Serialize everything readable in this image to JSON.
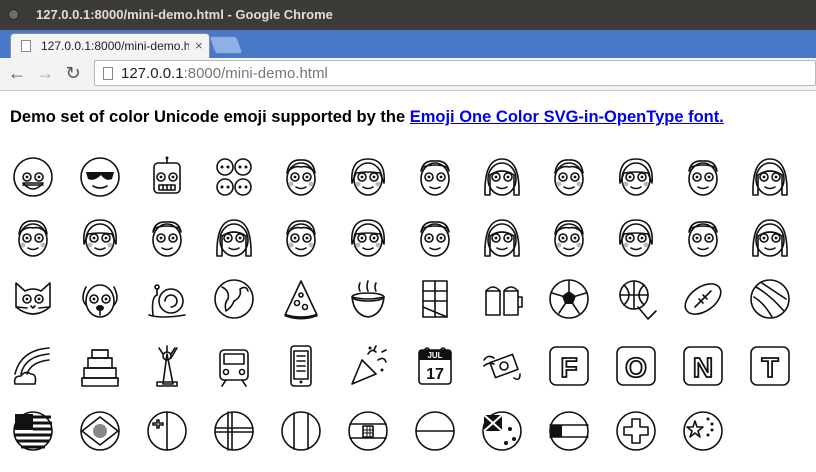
{
  "window": {
    "title": "127.0.0.1:8000/mini-demo.html - Google Chrome"
  },
  "tab": {
    "title": "127.0.0.1:8000/mini-demo.html",
    "close": "×"
  },
  "toolbar": {
    "back": "←",
    "forward": "→",
    "reload": "↻"
  },
  "address": {
    "host": "127.0.0.1",
    "rest": ":8000/mini-demo.html"
  },
  "page": {
    "heading_text": "Demo set of color Unicode emoji supported by the ",
    "heading_link": "Emoji One Color SVG-in-OpenType font."
  },
  "emoji_rows": [
    [
      "grinning-face",
      "sunglasses-face",
      "robot-face",
      "family",
      "boy",
      "girl",
      "man",
      "woman",
      "boy",
      "girl",
      "man",
      "woman"
    ],
    [
      "boy",
      "girl",
      "man",
      "woman",
      "boy",
      "girl",
      "man",
      "woman",
      "boy",
      "girl",
      "man",
      "woman"
    ],
    [
      "cat-face",
      "dog-face",
      "snail",
      "globe",
      "pizza",
      "stew",
      "chocolate-bar",
      "beer-mugs",
      "soccer-ball",
      "basketball",
      "football",
      "volleyball"
    ],
    [
      "rainbow",
      "japanese-castle",
      "statue-of-liberty",
      "train",
      "mobile-phone",
      "party-popper",
      "calendar",
      "money-wings",
      "letter-f",
      "letter-o",
      "letter-n",
      "letter-t"
    ],
    [
      "flag-us",
      "flag-br",
      "flag-mt",
      "flag-dk",
      "flag-it",
      "flag-hr",
      "flag-id",
      "flag-nz",
      "flag-ae",
      "flag-ch",
      "flag-cn"
    ]
  ],
  "letters": {
    "letter-f": "F",
    "letter-o": "O",
    "letter-n": "N",
    "letter-t": "T"
  },
  "calendar": {
    "month": "JUL",
    "day": "17"
  }
}
